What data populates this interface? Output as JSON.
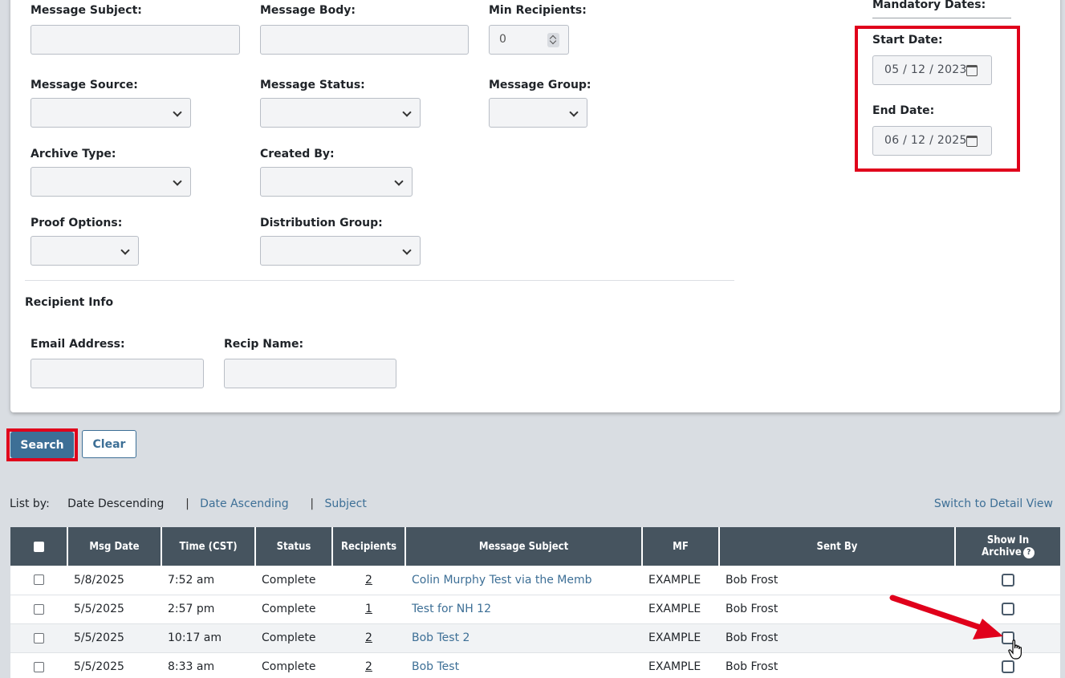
{
  "filters": {
    "message_subject_label": "Message Subject:",
    "message_body_label": "Message Body:",
    "min_recipients_label": "Min Recipients:",
    "min_recipients_value": "0",
    "message_source_label": "Message Source:",
    "message_status_label": "Message Status:",
    "message_group_label": "Message Group:",
    "archive_type_label": "Archive Type:",
    "created_by_label": "Created By:",
    "proof_options_label": "Proof Options:",
    "distribution_group_label": "Distribution Group:"
  },
  "dates": {
    "mandatory_label": "Mandatory Dates:",
    "start_label": "Start Date:",
    "start_value": "05 / 12 / 2023",
    "end_label": "End Date:",
    "end_value": "06 / 12 / 2025"
  },
  "recipient": {
    "section_title": "Recipient Info",
    "email_label": "Email Address:",
    "name_label": "Recip Name:"
  },
  "actions": {
    "search": "Search",
    "clear": "Clear"
  },
  "listby": {
    "label": "List by:",
    "current": "Date Descending",
    "sep": "|",
    "asc": "Date Ascending",
    "subject": "Subject",
    "detail_view": "Switch to Detail View"
  },
  "table": {
    "headers": {
      "msg_date": "Msg Date",
      "time": "Time (CST)",
      "status": "Status",
      "recipients": "Recipients",
      "subject": "Message Subject",
      "mf": "MF",
      "sent_by": "Sent By",
      "show_in": "Show In",
      "archive": "Archive",
      "help": "?"
    },
    "rows": [
      {
        "date": "5/8/2025",
        "time": "7:52 am",
        "status": "Complete",
        "recipients": "2",
        "subject": "Colin Murphy Test via the Memb",
        "mf": "EXAMPLE",
        "sent_by": "Bob Frost"
      },
      {
        "date": "5/5/2025",
        "time": "2:57 pm",
        "status": "Complete",
        "recipients": "1",
        "subject": "Test for NH 12",
        "mf": "EXAMPLE",
        "sent_by": "Bob Frost"
      },
      {
        "date": "5/5/2025",
        "time": "10:17 am",
        "status": "Complete",
        "recipients": "2",
        "subject": "Bob Test 2",
        "mf": "EXAMPLE",
        "sent_by": "Bob Frost"
      },
      {
        "date": "5/5/2025",
        "time": "8:33 am",
        "status": "Complete",
        "recipients": "2",
        "subject": "Bob Test",
        "mf": "EXAMPLE",
        "sent_by": "Bob Frost"
      }
    ]
  },
  "colors": {
    "accent": "#3d6f96",
    "highlight": "#e0001b",
    "table_header": "#46545f"
  },
  "icons": [
    "chevron-down-icon",
    "calendar-icon",
    "spinner-icon",
    "help-icon",
    "arrow-annotation",
    "hand-cursor-icon"
  ]
}
